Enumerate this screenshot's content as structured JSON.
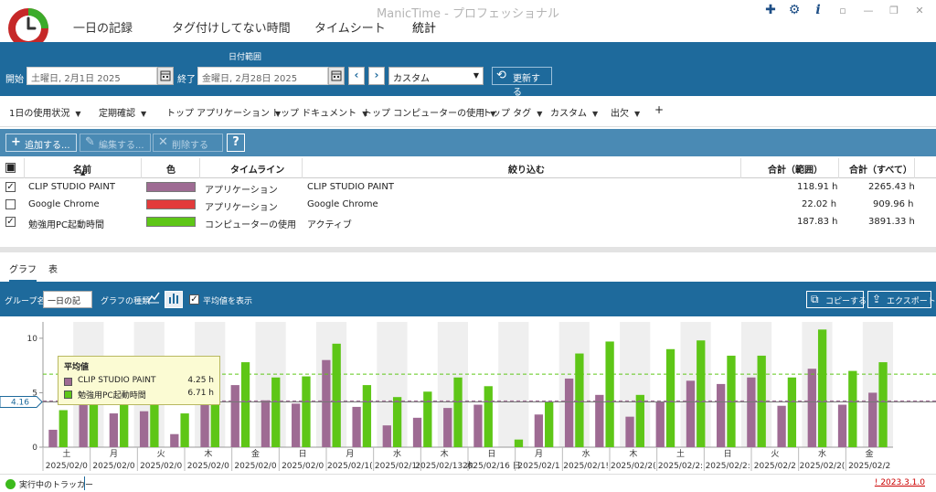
{
  "app": {
    "title": "ManicTime - プロフェッショナル",
    "version": "2023.3.1.0",
    "version_prefix": "!"
  },
  "nav": {
    "tabs": [
      {
        "label": "一日の記録",
        "active": false
      },
      {
        "label": "タグ付けしてない時間",
        "active": false
      },
      {
        "label": "タイムシート",
        "active": false
      },
      {
        "label": "統計",
        "active": true
      }
    ]
  },
  "date_range": {
    "section_label": "日付範囲",
    "start_label": "開始",
    "start_value": "土曜日, 2月1日 2025",
    "end_label": "終了",
    "end_value": "金曜日, 2月28日 2025",
    "preset_value": "カスタム",
    "refresh_label": "更新する"
  },
  "report_tabs": [
    {
      "label": "1日の使用状況"
    },
    {
      "label": "定期確認"
    },
    {
      "label": "トップ アプリケーション"
    },
    {
      "label": "トップ ドキュメント"
    },
    {
      "label": "トップ コンピューターの使用"
    },
    {
      "label": "トップ タグ"
    },
    {
      "label": "カスタム"
    },
    {
      "label": "出欠"
    }
  ],
  "report_tabs_add": "+",
  "toolbar": {
    "add_label": "追加する...",
    "edit_label": "編集する...",
    "delete_label": "削除する",
    "help_label": "?"
  },
  "table": {
    "headers": {
      "name": "名前",
      "color": "色",
      "timeline": "タイムライン",
      "filter": "絞り込む",
      "total_range": "合計（範囲）",
      "total_all": "合計（すべて）"
    },
    "rows": [
      {
        "checked": true,
        "name": "CLIP STUDIO PAINT",
        "color": "#9e6b93",
        "timeline": "アプリケーション",
        "filter": "CLIP STUDIO PAINT",
        "total_range": "118.91 h",
        "total_all": "2265.43 h"
      },
      {
        "checked": false,
        "name": "Google Chrome",
        "color": "#e23b3b",
        "timeline": "アプリケーション",
        "filter": "Google Chrome",
        "total_range": "22.02 h",
        "total_all": "909.96 h"
      },
      {
        "checked": true,
        "name": "勉強用PC起動時間",
        "color": "#5ec617",
        "timeline": "コンピューターの使用",
        "filter": "アクティブ",
        "total_range": "187.83 h",
        "total_all": "3891.33 h"
      }
    ]
  },
  "view_tabs": {
    "graph": "グラフ",
    "table": "表"
  },
  "graph_bar": {
    "group_label": "グループ名",
    "group_value": "一日の記",
    "type_label": "グラフの種類",
    "show_avg_label": "平均値を表示",
    "show_avg_checked": true,
    "copy_label": "コピーする",
    "export_label": "エクスポート"
  },
  "legend": {
    "title": "平均値",
    "items": [
      {
        "name": "CLIP STUDIO PAINT",
        "value": "4.25 h",
        "color": "#9e6b93"
      },
      {
        "name": "勉強用PC起動時間",
        "value": "6.71 h",
        "color": "#5ec617"
      }
    ]
  },
  "chart_data": {
    "type": "bar",
    "ylim": [
      0,
      11.5
    ],
    "yticks": [
      0,
      5,
      10
    ],
    "avg_marker_label": "4.16",
    "series": [
      {
        "name": "CLIP STUDIO PAINT",
        "color": "#9e6b93",
        "average": 4.25,
        "values": [
          1.6,
          4.8,
          3.1,
          3.3,
          1.2,
          4.3,
          5.7,
          4.3,
          4.0,
          8.0,
          3.7,
          2.0,
          2.7,
          3.6,
          3.9,
          0,
          3.0,
          6.3,
          4.8,
          2.8,
          4.2,
          6.1,
          5.8,
          6.4,
          3.8,
          7.2,
          3.9,
          5.0
        ]
      },
      {
        "name": "勉強用PC起動時間",
        "color": "#5ec617",
        "average": 6.71,
        "values": [
          3.4,
          5.6,
          6.2,
          7.3,
          3.1,
          6.5,
          7.8,
          6.4,
          6.5,
          9.5,
          5.7,
          4.6,
          5.1,
          6.4,
          5.6,
          0.7,
          4.2,
          8.6,
          9.7,
          4.8,
          9.0,
          9.8,
          8.4,
          8.4,
          6.4,
          10.8,
          7.0,
          7.8
        ]
      }
    ],
    "x_days": [
      "土",
      "日",
      "月",
      "火",
      "水",
      "木",
      "金",
      "土",
      "日",
      "月",
      "火",
      "水",
      "木",
      "金",
      "土",
      "日",
      "月",
      "火",
      "水",
      "木",
      "金",
      "土",
      "日",
      "月",
      "火",
      "水",
      "木",
      "金"
    ],
    "x_labels": [
      {
        "i": 0,
        "day": "土",
        "date": "2025/02/0"
      },
      {
        "i": 2,
        "day": "月",
        "date": "2025/02/0"
      },
      {
        "i": 4,
        "day": "火",
        "date": "2025/02/0"
      },
      {
        "i": 6,
        "day": "木",
        "date": "2025/02/0"
      },
      {
        "i": 8,
        "day": "金",
        "date": "2025/02/0"
      },
      {
        "i": 10,
        "day": "日",
        "date": "2025/02/0"
      },
      {
        "i": 12,
        "day": "月",
        "date": "2025/02/1("
      },
      {
        "i": 14,
        "day": "水",
        "date": "2025/02/1:"
      },
      {
        "i": 16,
        "day": "木",
        "date": "2025/02/13 木"
      },
      {
        "i": 18,
        "day": "日",
        "date": "2025/02/16 日"
      },
      {
        "i": 20,
        "day": "月",
        "date": "2025/02/1"
      },
      {
        "i": 22,
        "day": "水",
        "date": "2025/02/1!"
      },
      {
        "i": 24,
        "day": "木",
        "date": "2025/02/2("
      },
      {
        "i": 26,
        "day": "土",
        "date": "2025/02/2:"
      },
      {
        "i": 28,
        "day": "日",
        "date": "2025/02/2:"
      },
      {
        "i": 30,
        "day": "火",
        "date": "2025/02/2"
      },
      {
        "i": 32,
        "day": "水",
        "date": "2025/02/2("
      },
      {
        "i": 34,
        "day": "金",
        "date": "2025/02/2"
      }
    ]
  },
  "status": {
    "tracker_label": "実行中のトラッカー"
  }
}
